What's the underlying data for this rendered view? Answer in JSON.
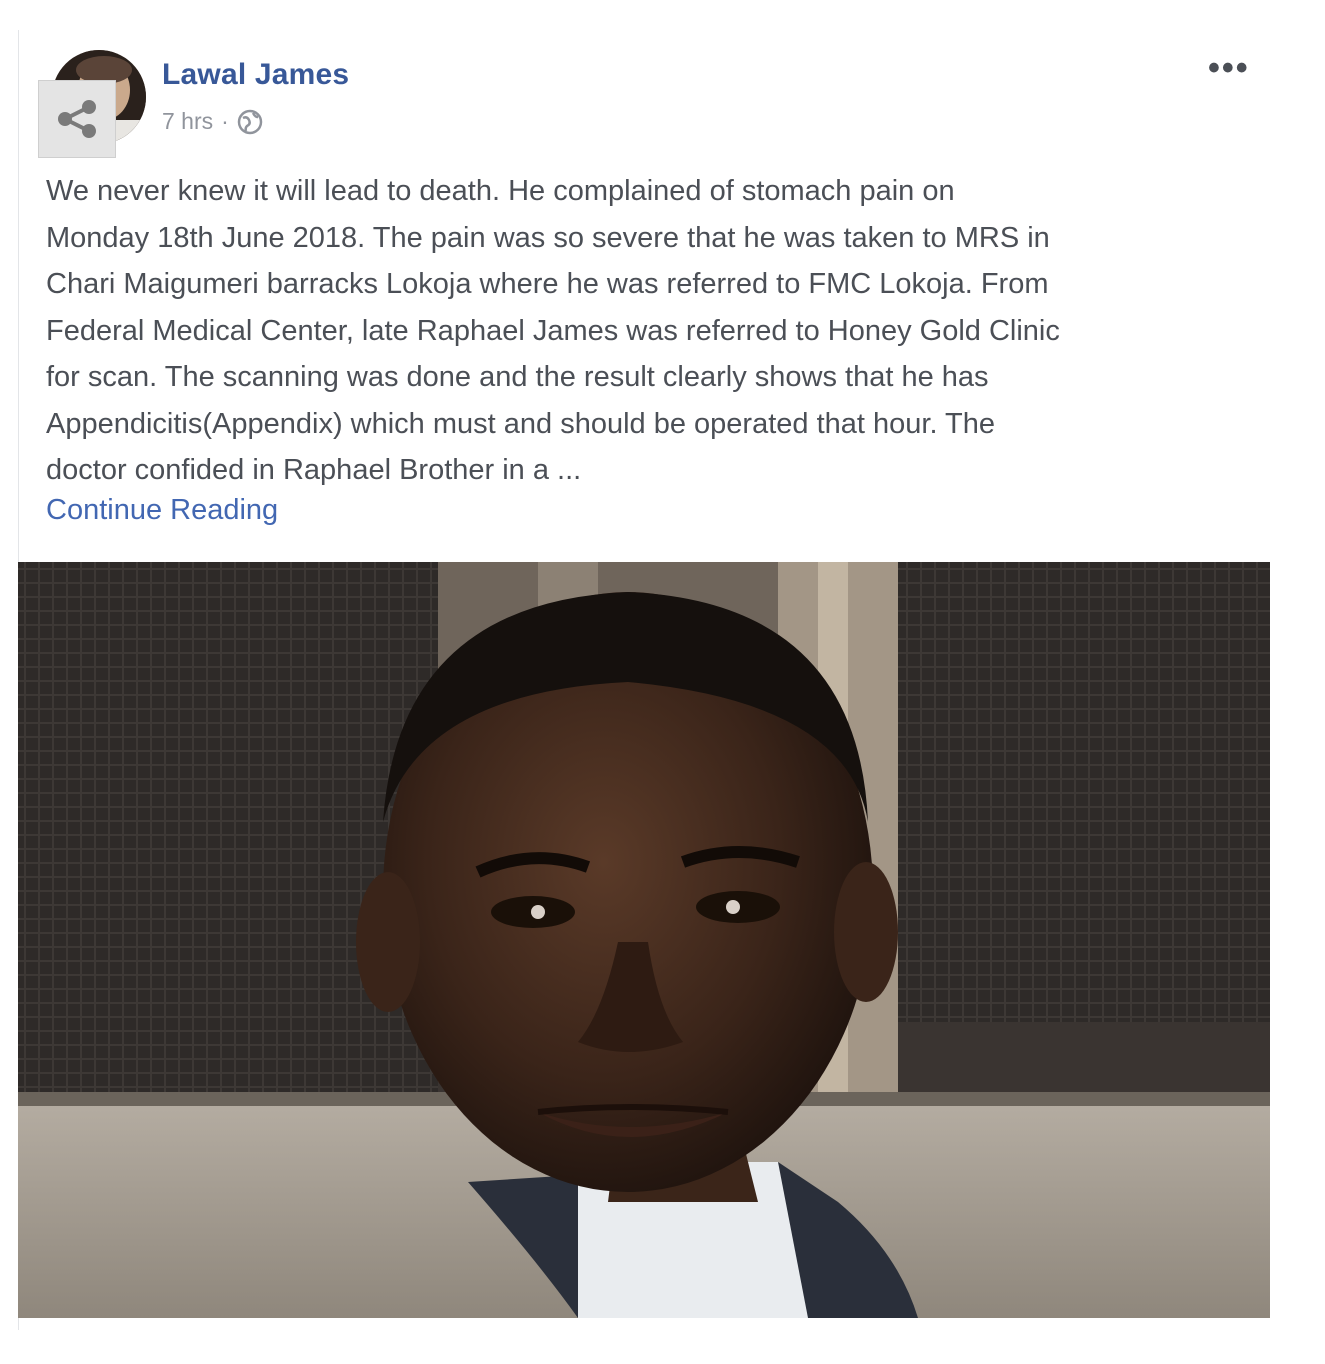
{
  "post": {
    "author": "Lawal James",
    "timestamp": "7 hrs",
    "separator": "·",
    "privacy_icon": "globe-icon",
    "more_label": "•••",
    "text": "We never knew it will lead to death. He complained of stomach pain on\nMonday 18th June 2018. The pain was so severe that he was taken to MRS in\nChari Maigumeri barracks Lokoja where he was referred to FMC Lokoja. From\nFederal Medical Center, late Raphael James was referred to Honey Gold Clinic\nfor scan. The scanning was done and the result clearly shows that he has\nAppendicitis(Appendix) which must and should be operated that hour. The\ndoctor confided in Raphael Brother in a ...",
    "continue_label": "Continue Reading",
    "share_icon": "share-icon"
  },
  "colors": {
    "author": "#385898",
    "body_text": "#4b4f56",
    "link": "#4267b2",
    "meta": "#90949c"
  }
}
